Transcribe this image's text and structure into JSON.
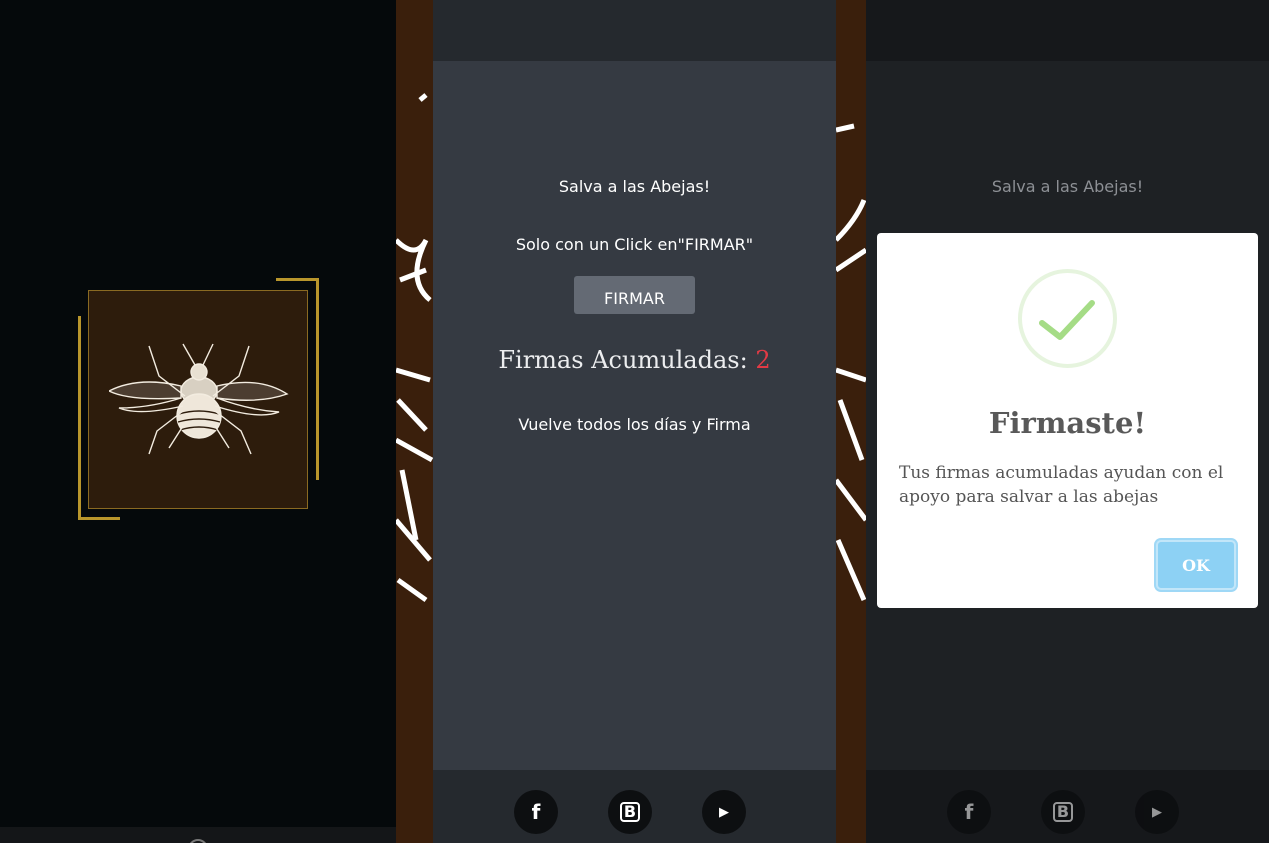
{
  "main": {
    "title": "Salva a las Abejas!",
    "subtitle": "Solo con un Click en\"FIRMAR\"",
    "sign_button": "FIRMAR",
    "counter_label": "Firmas Acumuladas: ",
    "counter_value": "2",
    "tip": "Vuelve todos los días y Firma"
  },
  "footer": {
    "icons": [
      {
        "name": "facebook-icon",
        "glyph": "f"
      },
      {
        "name": "blogger-icon",
        "glyph": "B"
      },
      {
        "name": "youtube-icon",
        "glyph": "▶"
      }
    ]
  },
  "dialog": {
    "title": "Firmaste!",
    "message": "Tus firmas acumuladas ayudan con el apoyo para salvar a las abejas",
    "ok_button": "OK"
  },
  "colors": {
    "background": "#05090b",
    "panel": "#353a42",
    "accent_gold": "#b9962c",
    "counter_red": "#e23a45",
    "ok_blue": "#8dd1f4",
    "check_green": "#a5dc86"
  }
}
